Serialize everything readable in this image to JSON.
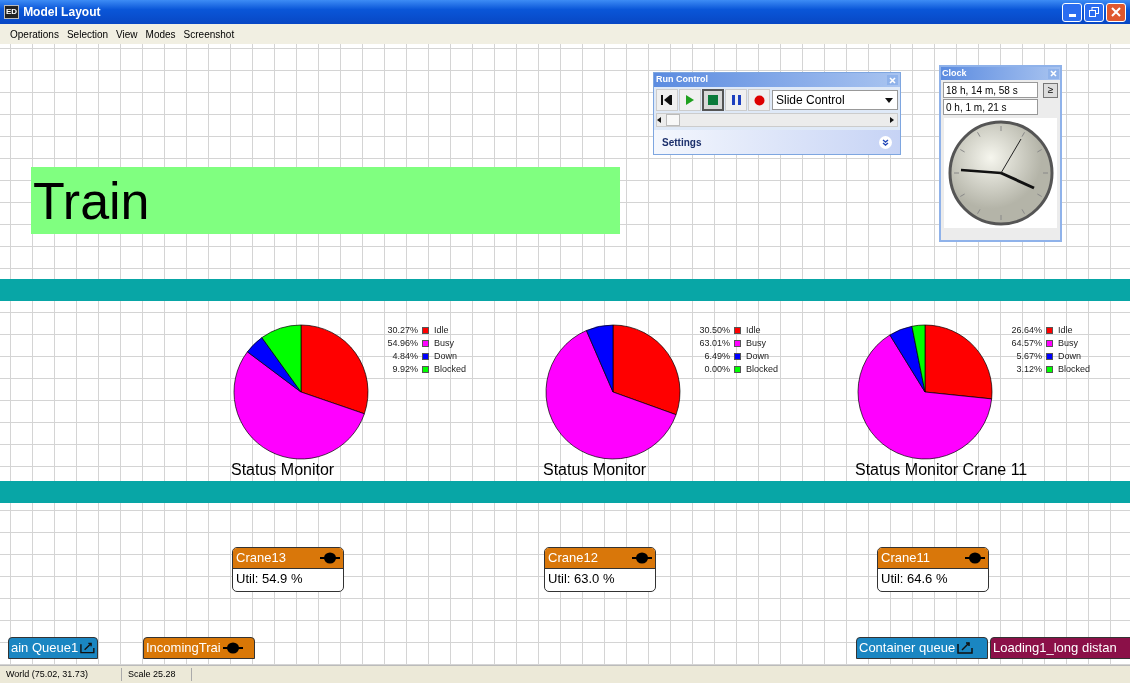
{
  "window": {
    "icon_text": "ED",
    "title": "Model Layout"
  },
  "menu": [
    "Operations",
    "Selection",
    "View",
    "Modes",
    "Screenshot"
  ],
  "train_label": "Train",
  "status_monitors": [
    {
      "title": "Status Monitor",
      "chart_data": {
        "type": "pie",
        "legend": "right",
        "categories": [
          "Idle",
          "Busy",
          "Down",
          "Blocked"
        ],
        "colors": [
          "#ff0000",
          "#ff00ff",
          "#0000ff",
          "#00ff00"
        ],
        "values": [
          30.27,
          54.96,
          4.84,
          9.92
        ],
        "value_labels": [
          "30.27%",
          "54.96%",
          "4.84%",
          "9.92%"
        ]
      }
    },
    {
      "title": "Status Monitor",
      "chart_data": {
        "type": "pie",
        "legend": "right",
        "categories": [
          "Idle",
          "Busy",
          "Down",
          "Blocked"
        ],
        "colors": [
          "#ff0000",
          "#ff00ff",
          "#0000ff",
          "#00ff00"
        ],
        "values": [
          30.5,
          63.01,
          6.49,
          0.0
        ],
        "value_labels": [
          "30.50%",
          "63.01%",
          "6.49%",
          "0.00%"
        ]
      }
    },
    {
      "title": "Status Monitor Crane 11",
      "chart_data": {
        "type": "pie",
        "legend": "right",
        "categories": [
          "Idle",
          "Busy",
          "Down",
          "Blocked"
        ],
        "colors": [
          "#ff0000",
          "#ff00ff",
          "#0000ff",
          "#00ff00"
        ],
        "values": [
          26.64,
          64.57,
          5.67,
          3.12
        ],
        "value_labels": [
          "26.64%",
          "64.57%",
          "5.67%",
          "3.12%"
        ]
      }
    }
  ],
  "cranes": [
    {
      "name": "Crane13",
      "util": "Util: 54.9 %"
    },
    {
      "name": "Crane12",
      "util": "Util: 63.0 %"
    },
    {
      "name": "Crane11",
      "util": "Util: 64.6 %"
    }
  ],
  "bottom_nodes": [
    {
      "kind": "queue",
      "label": "ain Queue1",
      "color": "#1a86c2"
    },
    {
      "kind": "source",
      "label": "IncomingTrai",
      "color": "#d97706"
    },
    {
      "kind": "queue",
      "label": "Container queue",
      "color": "#1a86c2"
    },
    {
      "kind": "plain",
      "label": "Loading1_long distan",
      "color": "#8b1048"
    }
  ],
  "run_control": {
    "title": "Run Control",
    "buttons": [
      {
        "kind": "reset",
        "selected": false
      },
      {
        "kind": "play",
        "selected": false
      },
      {
        "kind": "stop",
        "selected": true
      },
      {
        "kind": "pause",
        "selected": false
      },
      {
        "kind": "record",
        "selected": false
      }
    ],
    "mode": "Slide Control",
    "settings": "Settings"
  },
  "clock": {
    "title": "Clock",
    "time": "18 h, 14 m, 58 s",
    "step": "0 h, 1 m, 21 s",
    "step_button": "≥"
  },
  "status_bar": [
    "World (75.02, 31.73)",
    "Scale 25.28"
  ]
}
